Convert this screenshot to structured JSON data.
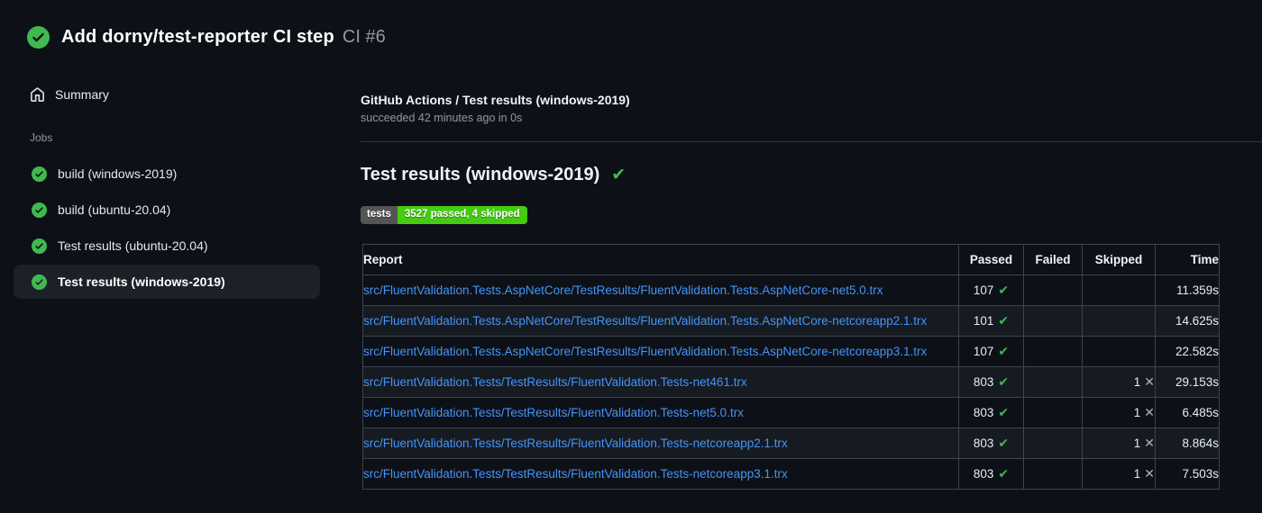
{
  "colors": {
    "background": "#0d1117",
    "success_green": "#3fb950",
    "badge_label_bg": "#555555",
    "badge_value_bg": "#44cc11",
    "link_blue": "#4493f8",
    "selected_item_bg": "#1c2128"
  },
  "header": {
    "title": "Add dorny/test-reporter CI step",
    "run_number": "CI #6",
    "status_icon": "check-circle-icon"
  },
  "sidebar": {
    "summary_label": "Summary",
    "jobs_label": "Jobs",
    "jobs": [
      {
        "label": "build (windows-2019)",
        "status": "success",
        "selected": false
      },
      {
        "label": "build (ubuntu-20.04)",
        "status": "success",
        "selected": false
      },
      {
        "label": "Test results (ubuntu-20.04)",
        "status": "success",
        "selected": false
      },
      {
        "label": "Test results (windows-2019)",
        "status": "success",
        "selected": true
      }
    ]
  },
  "main": {
    "job_title": "GitHub Actions / Test results (windows-2019)",
    "job_status": "succeeded 42 minutes ago in 0s",
    "section_title": "Test results (windows-2019)",
    "section_check": "✔",
    "badge": {
      "label": "tests",
      "value": "3527 passed, 4 skipped"
    },
    "table": {
      "headers": [
        "Report",
        "Passed",
        "Failed",
        "Skipped",
        "Time"
      ],
      "check_glyph": "✔",
      "x_glyph": "✕",
      "rows": [
        {
          "report": "src/FluentValidation.Tests.AspNetCore/TestResults/FluentValidation.Tests.AspNetCore-net5.0.trx",
          "passed": "107",
          "failed": "",
          "skipped": "",
          "time": "11.359s"
        },
        {
          "report": "src/FluentValidation.Tests.AspNetCore/TestResults/FluentValidation.Tests.AspNetCore-netcoreapp2.1.trx",
          "passed": "101",
          "failed": "",
          "skipped": "",
          "time": "14.625s"
        },
        {
          "report": "src/FluentValidation.Tests.AspNetCore/TestResults/FluentValidation.Tests.AspNetCore-netcoreapp3.1.trx",
          "passed": "107",
          "failed": "",
          "skipped": "",
          "time": "22.582s"
        },
        {
          "report": "src/FluentValidation.Tests/TestResults/FluentValidation.Tests-net461.trx",
          "passed": "803",
          "failed": "",
          "skipped": "1",
          "time": "29.153s"
        },
        {
          "report": "src/FluentValidation.Tests/TestResults/FluentValidation.Tests-net5.0.trx",
          "passed": "803",
          "failed": "",
          "skipped": "1",
          "time": "6.485s"
        },
        {
          "report": "src/FluentValidation.Tests/TestResults/FluentValidation.Tests-netcoreapp2.1.trx",
          "passed": "803",
          "failed": "",
          "skipped": "1",
          "time": "8.864s"
        },
        {
          "report": "src/FluentValidation.Tests/TestResults/FluentValidation.Tests-netcoreapp3.1.trx",
          "passed": "803",
          "failed": "",
          "skipped": "1",
          "time": "7.503s"
        }
      ]
    }
  }
}
